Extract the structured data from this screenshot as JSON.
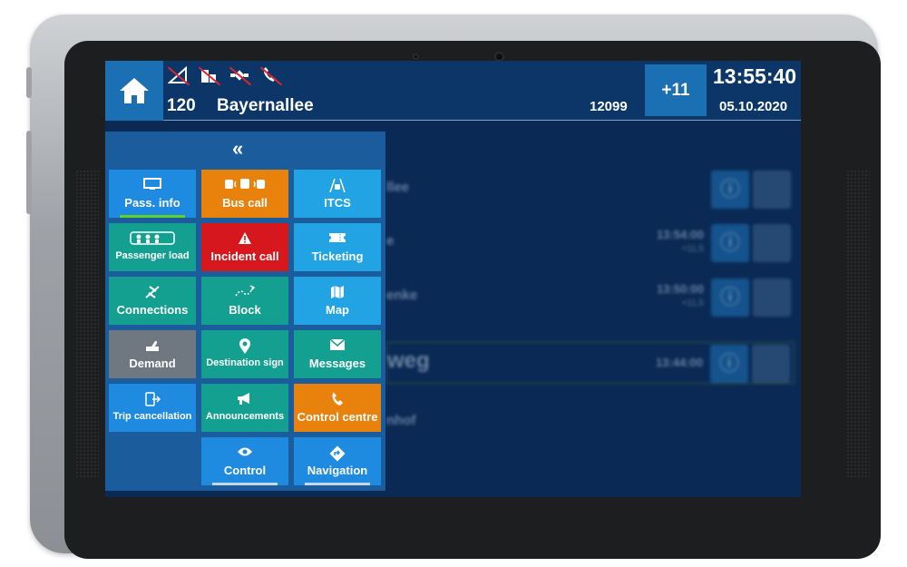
{
  "header": {
    "line_number": "120",
    "stop_name": "Bayernallee",
    "vehicle_number": "12099",
    "delay_badge": "+11",
    "time": "13:55:40",
    "date": "05.10.2020",
    "status_icons": [
      "signal-off-icon",
      "network-off-icon",
      "gps-off-icon",
      "phone-off-icon"
    ]
  },
  "stop_list": [
    {
      "name": "llee",
      "time": "",
      "delay": ""
    },
    {
      "name": "e",
      "time": "13:54:00",
      "delay": "+11,5"
    },
    {
      "name": "enke",
      "time": "13:50:00",
      "delay": "+11,5"
    },
    {
      "name": "weg",
      "time": "13:44:00",
      "delay": ""
    },
    {
      "name": "nhof",
      "time": "",
      "delay": ""
    }
  ],
  "menu": {
    "collapse_icon": "double-chevron-left-icon",
    "tiles": [
      {
        "label": "Pass. info",
        "icon": "tft-display-icon",
        "color": "#1e8be0"
      },
      {
        "label": "Bus call",
        "icon": "bus-call-icon",
        "color": "#e8820c"
      },
      {
        "label": "ITCS",
        "icon": "road-bus-icon",
        "color": "#22a3e3"
      },
      {
        "label": "Passenger load",
        "icon": "passenger-load-icon",
        "color": "#14a091"
      },
      {
        "label": "Incident call",
        "icon": "warning-icon",
        "color": "#d6181e"
      },
      {
        "label": "Ticketing",
        "icon": "ticket-icon",
        "color": "#22a3e3"
      },
      {
        "label": "Connections",
        "icon": "connections-icon",
        "color": "#14a091"
      },
      {
        "label": "Block",
        "icon": "block-route-icon",
        "color": "#14a091"
      },
      {
        "label": "Map",
        "icon": "map-icon",
        "color": "#22a3e3"
      },
      {
        "label": "Demand",
        "icon": "demand-hand-icon",
        "color": "#6f7780"
      },
      {
        "label": "Destination sign",
        "icon": "destination-pin-icon",
        "color": "#14a091"
      },
      {
        "label": "Messages",
        "icon": "envelope-icon",
        "color": "#14a091"
      },
      {
        "label": "Trip cancellation",
        "icon": "trip-cancel-icon",
        "color": "#1e8be0"
      },
      {
        "label": "Announcements",
        "icon": "megaphone-icon",
        "color": "#14a091"
      },
      {
        "label": "Control centre",
        "icon": "phone-icon",
        "color": "#e8820c"
      },
      {
        "label": "Control",
        "icon": "eye-icon",
        "color": "#1e8be0"
      },
      {
        "label": "Navigation",
        "icon": "navigation-icon",
        "color": "#1e8be0"
      }
    ]
  }
}
